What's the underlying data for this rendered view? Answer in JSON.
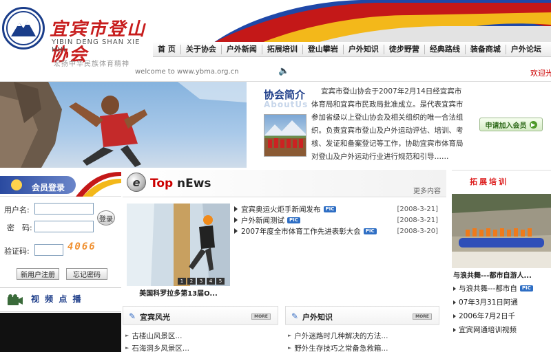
{
  "header": {
    "logo_cn": "宜宾市登山协会",
    "logo_en": "YIBIN DENG SHAN XIE HUI",
    "slogan": "宏扬中华民族体育精神",
    "welcome_text": "welcome to www.ybma.org.cn",
    "welcome_scroll": "欢迎光临",
    "nav": [
      "首 页",
      "关于协会",
      "户外新闻",
      "拓展培训",
      "登山攀岩",
      "户外知识",
      "徒步野营",
      "经典路线",
      "装备商城",
      "户外论坛"
    ]
  },
  "intro": {
    "title": "协会简介",
    "watermark": "AboutUs",
    "text": "宜宾市登山协会于2007年2月14日经宜宾市体育局和宜宾市民政局批准成立。是代表宜宾市参加省级以上登山协会及相关组织的唯一合法组织。负责宜宾市登山及户外运动评估、培训、考核、发证和备案登记等工作，协助宜宾市体育局对登山及户外运动行业进行规范和引导……",
    "join_label": "申请加入会员"
  },
  "member": {
    "title": "会员登录",
    "username_label": "用户名:",
    "password_label": "密　码:",
    "captcha_label": "验证码:",
    "captcha_code": "4066",
    "login_label": "登录",
    "register_label": "新用户注册",
    "forgot_label": "忘记密码"
  },
  "video": {
    "title": "视 频 点 播"
  },
  "topnews": {
    "top_word": "Top",
    "news_word": "nEws",
    "more_label": "更多内容",
    "photo_caption": "美国科罗拉多第13届O...",
    "photo_pages": [
      "1",
      "2",
      "3",
      "4",
      "5"
    ],
    "items": [
      {
        "title": "宜宾奥运火炬手新闻发布",
        "badge": "PIC",
        "date": "[2008-3-21]"
      },
      {
        "title": "户外新闻测试",
        "badge": "PIC",
        "date": "[2008-3-21]"
      },
      {
        "title": "2007年度全市体育工作先进表彰大会",
        "badge": "PIC",
        "date": "[2008-3-20]"
      }
    ]
  },
  "scenery": {
    "title": "宜宾风光",
    "more_label": "MORE",
    "items": [
      "古楼山风景区...",
      "石海洞乡风景区..."
    ]
  },
  "knowledge": {
    "title": "户外知识",
    "more_label": "MORE",
    "items": [
      "户外迷路时几种解决的方法...",
      "野外生存技巧之常备急救箱..."
    ]
  },
  "training": {
    "title": "拓展培训",
    "photo_caption": "与浪共舞---都市自游人...",
    "items": [
      {
        "title": "与浪共舞---都市自",
        "badge": "PIC"
      },
      {
        "title": "07年3月31日阿通",
        "badge": ""
      },
      {
        "title": "2006年7月2日千",
        "badge": ""
      },
      {
        "title": "宜宾网通培训视频",
        "badge": ""
      }
    ]
  },
  "colors": {
    "brand_blue": "#1d3d89",
    "brand_red": "#cc0000",
    "accent_yellow": "#f3b81a"
  }
}
